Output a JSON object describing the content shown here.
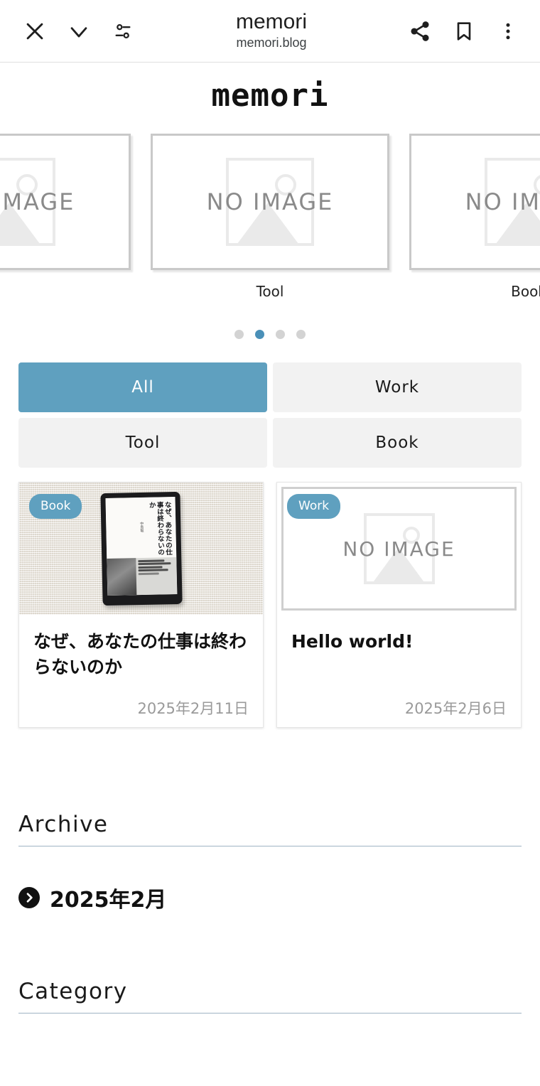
{
  "browser": {
    "title": "memori",
    "url": "memori.blog",
    "icons": {
      "close": "close-icon",
      "collapse": "chevron-down-icon",
      "site_settings": "tune-sliders-icon",
      "share": "share-icon",
      "bookmark": "bookmark-icon",
      "overflow": "more-vertical-icon"
    }
  },
  "site": {
    "logo_text": "memori"
  },
  "carousel": {
    "placeholder_text": "NO IMAGE",
    "slides": [
      {
        "label": "",
        "image": "NO IMAGE",
        "partial": true
      },
      {
        "label": "Tool",
        "image": "NO IMAGE",
        "partial": false
      },
      {
        "label": "Book",
        "image": "NO IMAGE",
        "partial": true
      }
    ],
    "dots": {
      "count": 4,
      "active_index": 1
    },
    "active_color": "#4a90b8",
    "inactive_color": "#d3d3d3"
  },
  "filters": {
    "active_color": "#5fa0bf",
    "inactive_color": "#f2f2f2",
    "items": [
      {
        "label": "All",
        "active": true
      },
      {
        "label": "Work",
        "active": false
      },
      {
        "label": "Tool",
        "active": false
      },
      {
        "label": "Book",
        "active": false
      }
    ]
  },
  "posts": [
    {
      "badge": "Book",
      "title": "なぜ、あなたの仕事は終わらないのか",
      "date": "2025年2月11日",
      "has_image": true,
      "cover_title": "なぜ、あなたの仕事は終わらないのか",
      "cover_author": "中島聡"
    },
    {
      "badge": "Work",
      "title": "Hello world!",
      "date": "2025年2月6日",
      "has_image": false,
      "placeholder_text": "NO IMAGE"
    }
  ],
  "archive": {
    "heading": "Archive",
    "items": [
      {
        "label": "2025年2月"
      }
    ]
  },
  "category": {
    "heading": "Category"
  }
}
